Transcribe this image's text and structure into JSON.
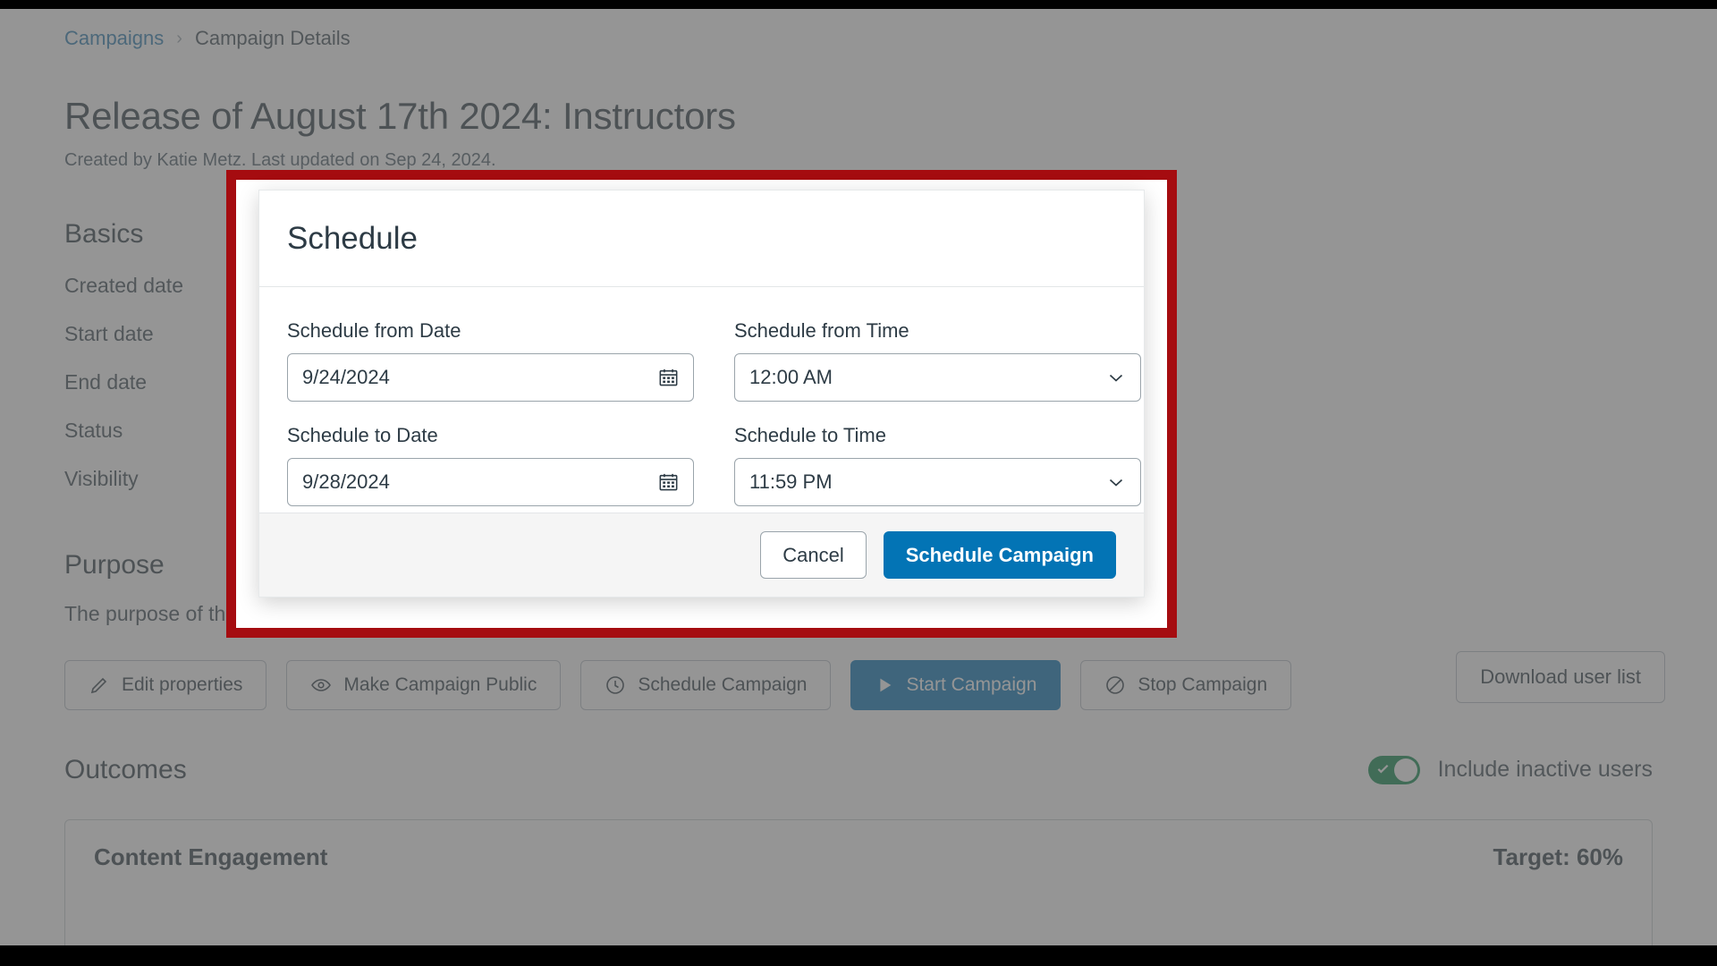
{
  "breadcrumb": {
    "parent": "Campaigns",
    "separator": "›",
    "current": "Campaign Details"
  },
  "header": {
    "title": "Release of August 17th 2024: Instructors",
    "subtitle": "Created by Katie Metz. Last updated on Sep 24, 2024."
  },
  "basics": {
    "heading": "Basics",
    "fields": [
      {
        "label": "Created date"
      },
      {
        "label": "Start date"
      },
      {
        "label": "End date"
      },
      {
        "label": "Status"
      },
      {
        "label": "Visibility"
      }
    ]
  },
  "purpose": {
    "heading": "Purpose",
    "text": "The purpose of this campaign is to inform instructors about the release update of August 17th, 2024."
  },
  "toolbar": {
    "buttons": [
      {
        "label": "Edit properties",
        "icon": "pencil-icon",
        "variant": "default"
      },
      {
        "label": "Make Campaign Public",
        "icon": "eye-icon",
        "variant": "default"
      },
      {
        "label": "Schedule Campaign",
        "icon": "clock-icon",
        "variant": "default"
      },
      {
        "label": "Start Campaign",
        "icon": "play-icon",
        "variant": "primary"
      },
      {
        "label": "Stop Campaign",
        "icon": "no-entry-icon",
        "variant": "default"
      }
    ],
    "download_user_list": "Download user list"
  },
  "outcomes": {
    "heading": "Outcomes",
    "toggle": {
      "label": "Include inactive users",
      "state": "on",
      "color": "#0b874b"
    },
    "cards": [
      {
        "name": "Content Engagement",
        "target": "Target: 60%"
      }
    ]
  },
  "modal": {
    "title": "Schedule",
    "fields": [
      {
        "label": "Schedule from Date",
        "value": "9/24/2024",
        "type": "date",
        "icon": "calendar-icon"
      },
      {
        "label": "Schedule from Time",
        "value": "12:00 AM",
        "type": "select",
        "icon": "chevron-down-icon"
      },
      {
        "label": "Schedule to Date",
        "value": "9/28/2024",
        "type": "date",
        "icon": "calendar-icon"
      },
      {
        "label": "Schedule to Time",
        "value": "11:59 PM",
        "type": "select",
        "icon": "chevron-down-icon"
      }
    ],
    "cancel_label": "Cancel",
    "submit_label": "Schedule Campaign"
  },
  "colors": {
    "accent": "#0374b5",
    "highlight_frame": "#a50c10",
    "text_primary": "#2d3b45",
    "link": "#2b7cb0",
    "toggle_on": "#0b874b"
  }
}
